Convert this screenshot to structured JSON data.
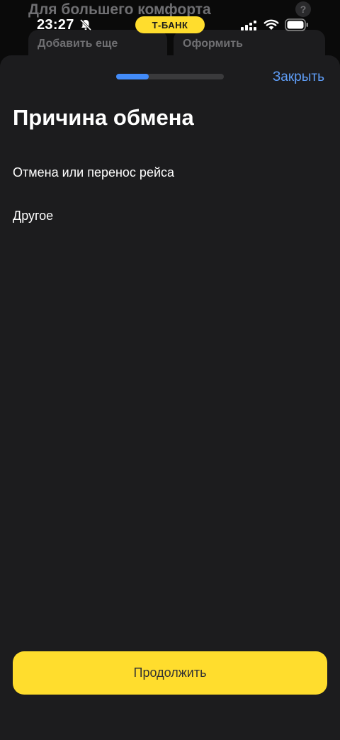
{
  "background": {
    "section_title": "Для большего комфорта",
    "help_label": "?",
    "cards": [
      "Добавить еще",
      "Оформить"
    ]
  },
  "status_bar": {
    "time": "23:27",
    "bank_label": "Т-БАНК"
  },
  "sheet": {
    "progress": 0.3,
    "close_label": "Закрыть",
    "title": "Причина обмена",
    "options": [
      "Отмена или перенос рейса",
      "Другое"
    ],
    "continue_label": "Продолжить"
  },
  "colors": {
    "accent_yellow": "#ffdd2d",
    "link_blue": "#5f9ef8",
    "progress_blue": "#428bf9",
    "sheet_bg": "#1c1c1e"
  }
}
